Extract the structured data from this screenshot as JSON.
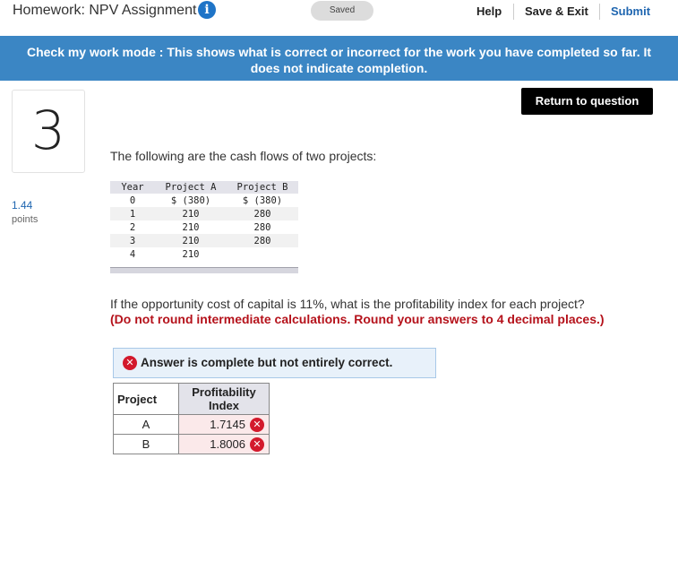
{
  "header": {
    "title": "Homework: NPV Assignment",
    "info_icon": "info-icon",
    "saved_label": "Saved",
    "help_label": "Help",
    "save_exit_label": "Save & Exit",
    "submit_label": "Submit"
  },
  "banner": {
    "text": "Check my work mode : This shows what is correct or incorrect for the work you have completed so far. It does not indicate completion."
  },
  "question_meta": {
    "number": "3",
    "points_value": "1.44",
    "points_label": "points",
    "return_label": "Return to question"
  },
  "intro_text": "The following are the cash flows of two projects:",
  "cash_flows": {
    "headers": [
      "Year",
      "Project A",
      "Project B"
    ],
    "rows": [
      [
        "0",
        "$ (380)",
        "$ (380)"
      ],
      [
        "1",
        "210",
        "280"
      ],
      [
        "2",
        "210",
        "280"
      ],
      [
        "3",
        "210",
        "280"
      ],
      [
        "4",
        "210",
        ""
      ]
    ]
  },
  "question_text": "If the opportunity cost of capital is 11%, what is the profitability index for each project?",
  "instruction_text": "(Do not round intermediate calculations. Round your answers to 4 decimal places.)",
  "answer": {
    "status": "Answer is complete but not entirely correct.",
    "table_headers": [
      "Project",
      "Profitability Index"
    ],
    "rows": [
      [
        "A",
        "1.7145"
      ],
      [
        "B",
        "1.8006"
      ]
    ],
    "incorrect_icon": "x-circle-icon"
  },
  "colors": {
    "banner": "#3b86c4",
    "link": "#1f66b0",
    "error": "#d3192c",
    "instruction": "#b5121b"
  }
}
